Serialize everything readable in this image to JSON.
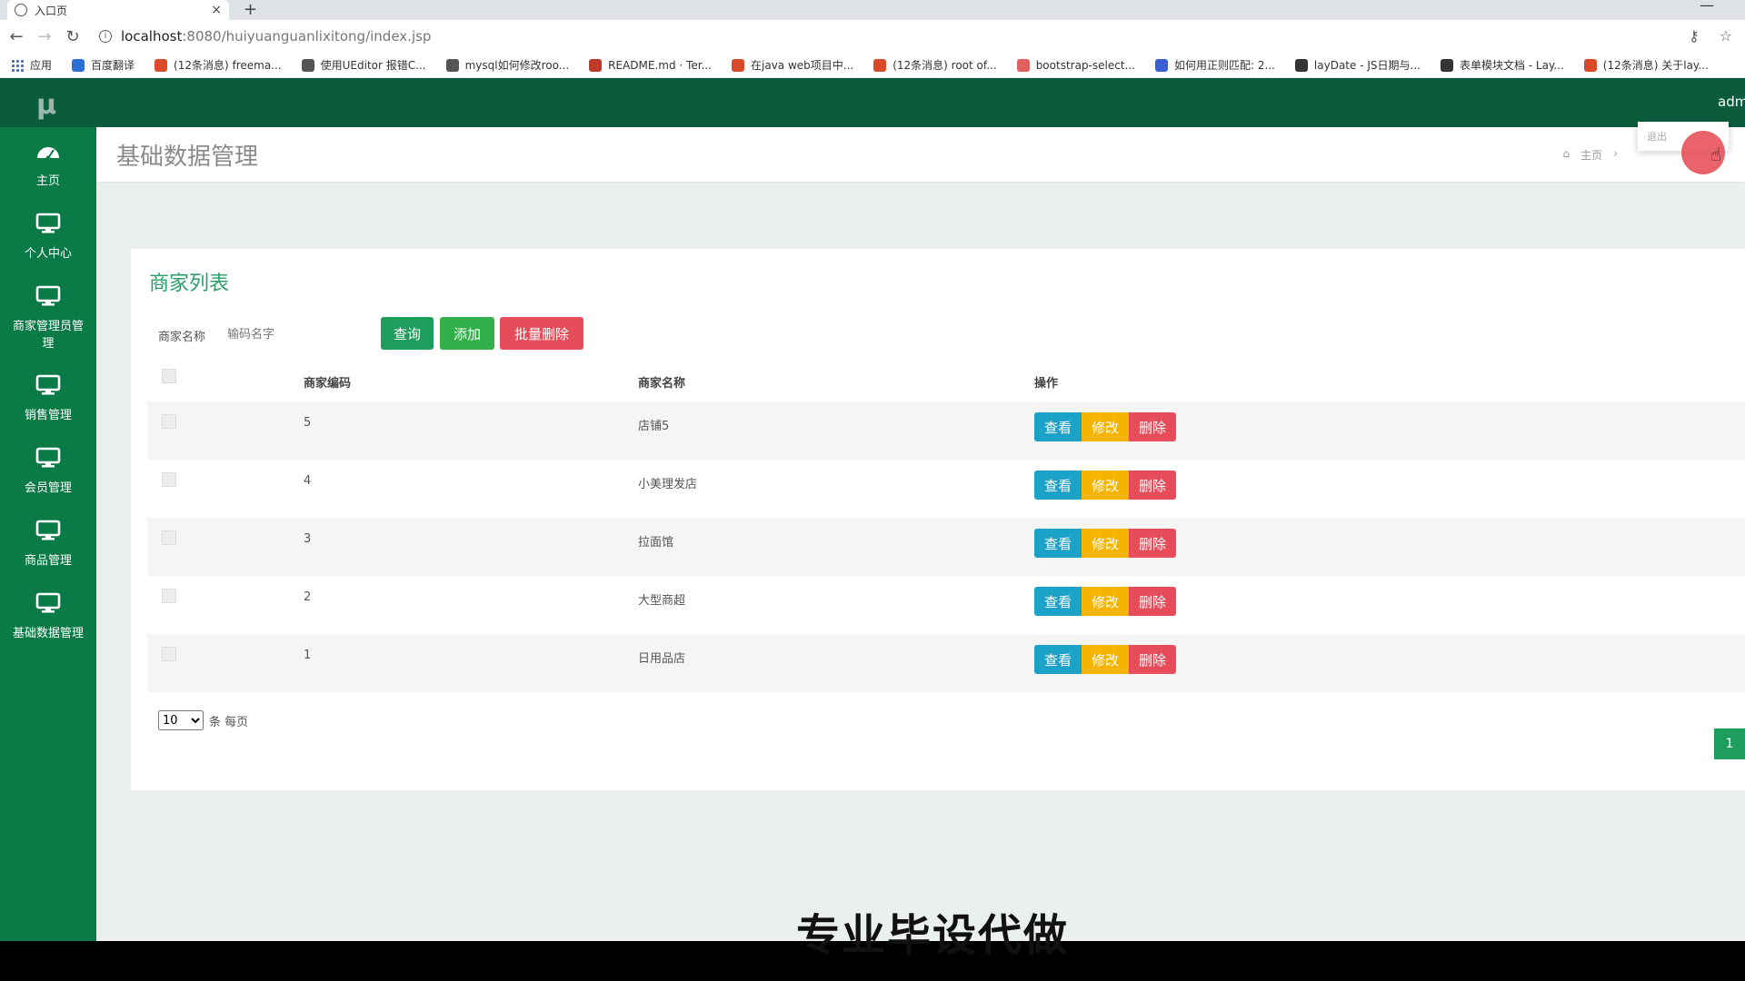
{
  "browser": {
    "tab_title": "入口页",
    "new_tab": "+",
    "url_host": "localhost",
    "url_path": ":8080/huiyuanguanlixitong/index.jsp",
    "bookmarks": [
      {
        "label": "应用",
        "color": "#4a6aa8"
      },
      {
        "label": "百度翻译",
        "color": "#2a6fd8"
      },
      {
        "label": "(12条消息) freema...",
        "color": "#d84a2a"
      },
      {
        "label": "使用UEditor 报错C...",
        "color": "#555555"
      },
      {
        "label": "mysql如何修改roo...",
        "color": "#555555"
      },
      {
        "label": "README.md · Ter...",
        "color": "#c0392b"
      },
      {
        "label": "在java web项目中...",
        "color": "#d84a2a"
      },
      {
        "label": "(12条消息) root of...",
        "color": "#d84a2a"
      },
      {
        "label": "bootstrap-select...",
        "color": "#e06060"
      },
      {
        "label": "如何用正则匹配: 2...",
        "color": "#3a5fd0"
      },
      {
        "label": "layDate - JS日期与...",
        "color": "#333333"
      },
      {
        "label": "表单模块文档 - Lay...",
        "color": "#333333"
      },
      {
        "label": "(12条消息) 关于lay...",
        "color": "#d84a2a"
      }
    ]
  },
  "app": {
    "logo": "μ",
    "user": "admin"
  },
  "sidebar": {
    "items": [
      {
        "label": "主页",
        "icon": "dashboard-icon"
      },
      {
        "label": "个人中心",
        "icon": "monitor-icon"
      },
      {
        "label": "商家管理员管理",
        "icon": "monitor-icon"
      },
      {
        "label": "销售管理",
        "icon": "monitor-icon"
      },
      {
        "label": "会员管理",
        "icon": "monitor-icon"
      },
      {
        "label": "商品管理",
        "icon": "monitor-icon"
      },
      {
        "label": "基础数据管理",
        "icon": "monitor-icon"
      }
    ]
  },
  "header": {
    "title": "基础数据管理",
    "breadcrumb_home": "主页",
    "breadcrumb_sep": "›",
    "popup_text": "退出"
  },
  "panel": {
    "title": "商家列表",
    "search_label": "商家名称",
    "search_placeholder": "输码名字",
    "btn_query": "查询",
    "btn_add": "添加",
    "btn_batch_delete": "批量删除"
  },
  "table": {
    "headers": {
      "code": "商家编码",
      "name": "商家名称",
      "op": "操作"
    },
    "rows": [
      {
        "code": "5",
        "name": "店铺5"
      },
      {
        "code": "4",
        "name": "小美理发店"
      },
      {
        "code": "3",
        "name": "拉面馆"
      },
      {
        "code": "2",
        "name": "大型商超"
      },
      {
        "code": "1",
        "name": "日用品店"
      }
    ],
    "op_view": "查看",
    "op_edit": "修改",
    "op_delete": "删除"
  },
  "pager": {
    "page_size": "10",
    "page_size_suffix": "条 每页",
    "current_page": "1"
  },
  "overlay": {
    "watermark": "专业毕设代做"
  },
  "colors": {
    "topbar": "#0a5c3c",
    "sidebar": "#0a7a47",
    "query": "#1e9e5c",
    "add": "#31b04a",
    "danger": "#e74c5a",
    "info": "#1aa3c6",
    "warning": "#f4b400"
  }
}
